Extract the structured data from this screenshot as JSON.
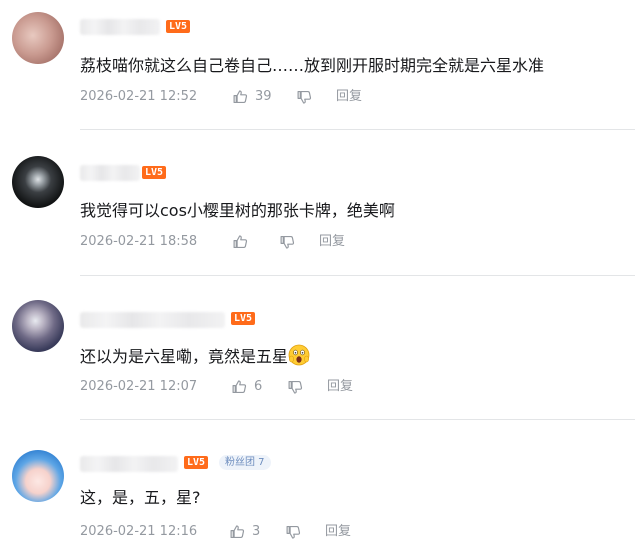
{
  "level_badge": "LV5",
  "comments": [
    {
      "text": "荔枝喵你就这么自己卷自己……放到刚开服时期完全就是六星水准",
      "time": "2026-02-21 12:52",
      "likes": "39",
      "reply_label": "回复"
    },
    {
      "text": "我觉得可以cos小樱里树的那张卡牌，绝美啊",
      "time": "2026-02-21 18:58",
      "likes": "",
      "reply_label": "回复"
    },
    {
      "text": "还以为是六星嘞，竟然是五星",
      "time": "2026-02-21 12:07",
      "likes": "6",
      "reply_label": "回复"
    },
    {
      "text": "这，是，五，星?",
      "time": "2026-02-21 12:16",
      "likes": "3",
      "reply_label": "回复",
      "fan_badge": "粉丝团 7"
    }
  ],
  "icons": [
    "thumbs-up-icon",
    "thumbs-down-icon",
    "scream-emoji-icon"
  ]
}
